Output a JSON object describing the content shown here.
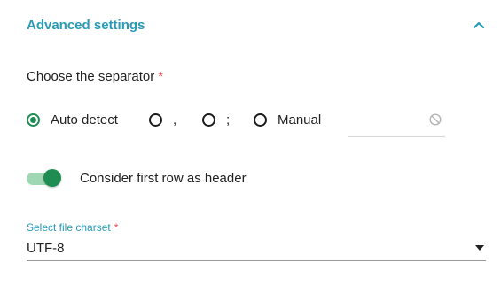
{
  "section": {
    "title": "Advanced settings",
    "collapse_icon": "chevron-up-icon"
  },
  "separator": {
    "label": "Choose the separator",
    "required_mark": "*",
    "options": [
      {
        "label": "Auto detect",
        "checked": true
      },
      {
        "label": ",",
        "checked": false
      },
      {
        "label": ";",
        "checked": false
      },
      {
        "label": "Manual",
        "checked": false
      }
    ],
    "manual_value": "",
    "manual_icon": "blocked-icon"
  },
  "header_toggle": {
    "label": "Consider first row as header",
    "on": true
  },
  "charset": {
    "label": "Select file charset",
    "required_mark": "*",
    "value": "UTF-8"
  },
  "colors": {
    "accent": "#2a9bb5",
    "green": "#1f8c52",
    "required": "#e5484d"
  }
}
